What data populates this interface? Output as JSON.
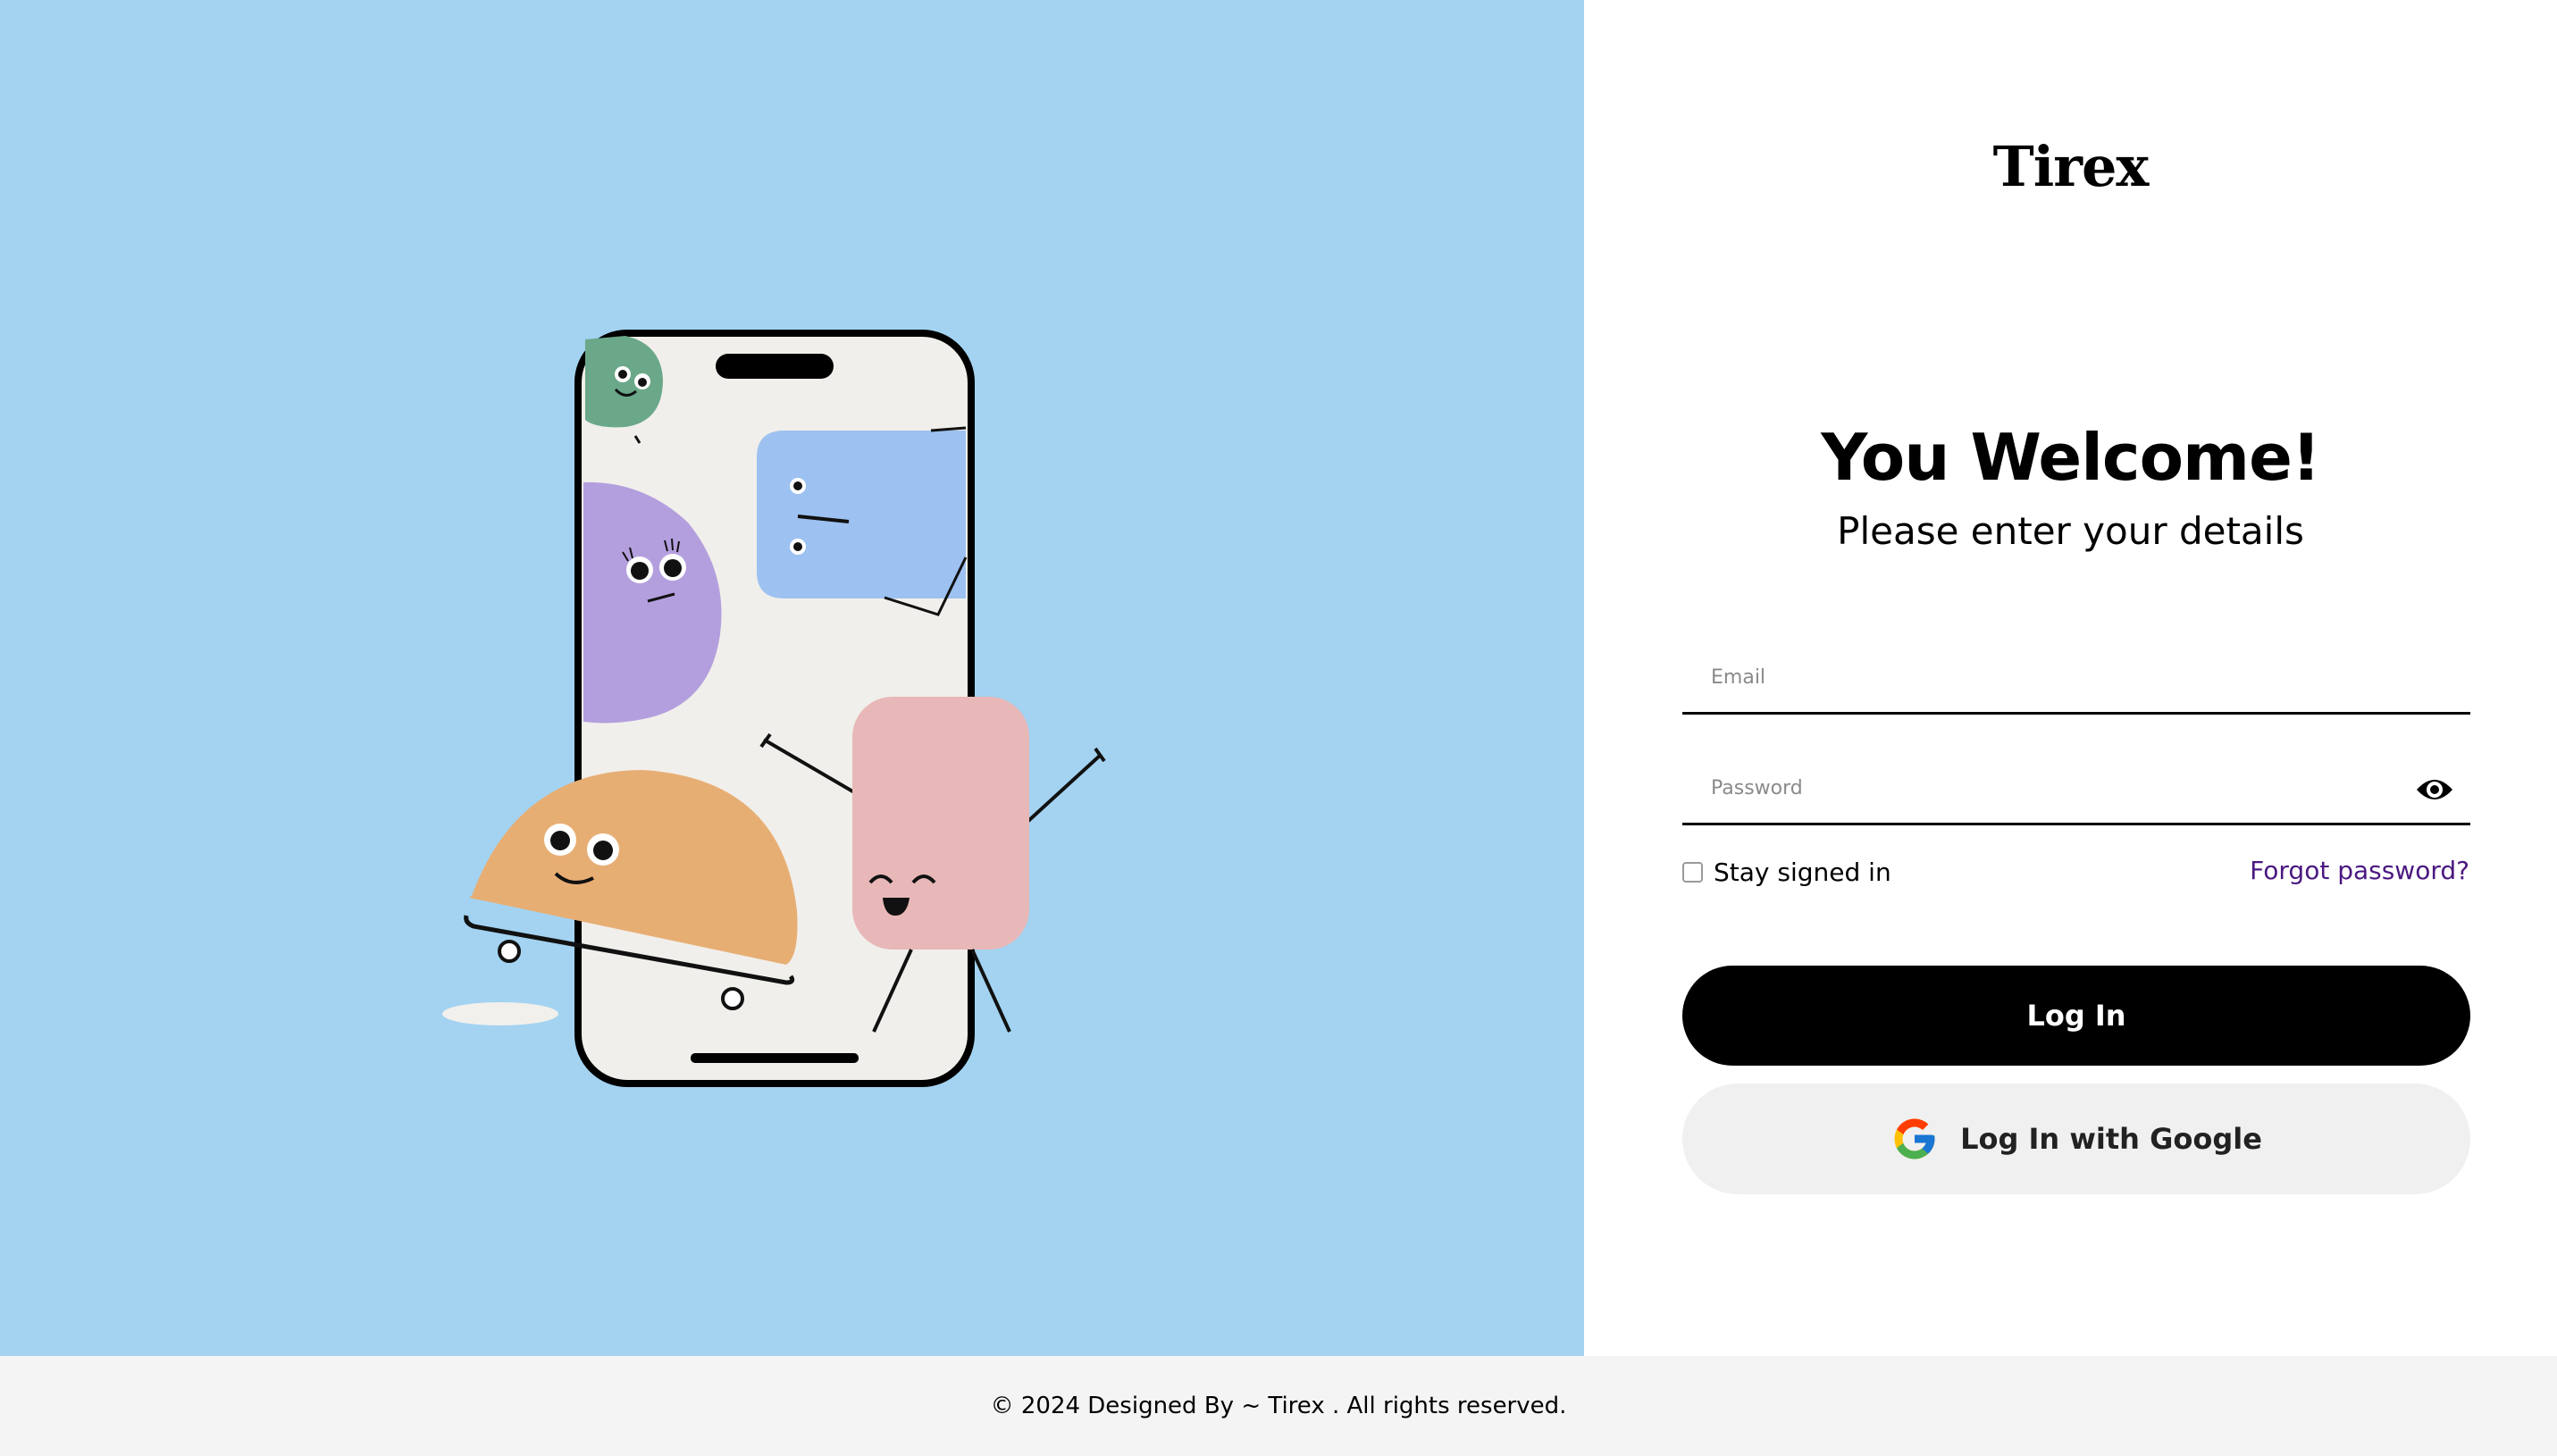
{
  "brand": {
    "name": "Tirex"
  },
  "hero": {
    "title": "You Welcome!",
    "subtitle": "Please enter your details"
  },
  "form": {
    "email": {
      "value": "",
      "placeholder": "Email"
    },
    "password": {
      "value": "",
      "placeholder": "Password",
      "toggle_icon": "eye-icon"
    },
    "remember_label": "Stay signed in",
    "remember_checked": false,
    "forgot_label": "Forgot password?",
    "login_label": "Log In",
    "google_label": "Log In with Google"
  },
  "footer": {
    "text": "© 2024 Designed By ~ Tirex . All rights reserved."
  },
  "colors": {
    "illustration_bg": "#a3d3f1",
    "primary_button": "#000000",
    "google_button_bg": "#f0f0f0",
    "link": "#4a1880",
    "footer_bg": "#f4f4f4"
  }
}
